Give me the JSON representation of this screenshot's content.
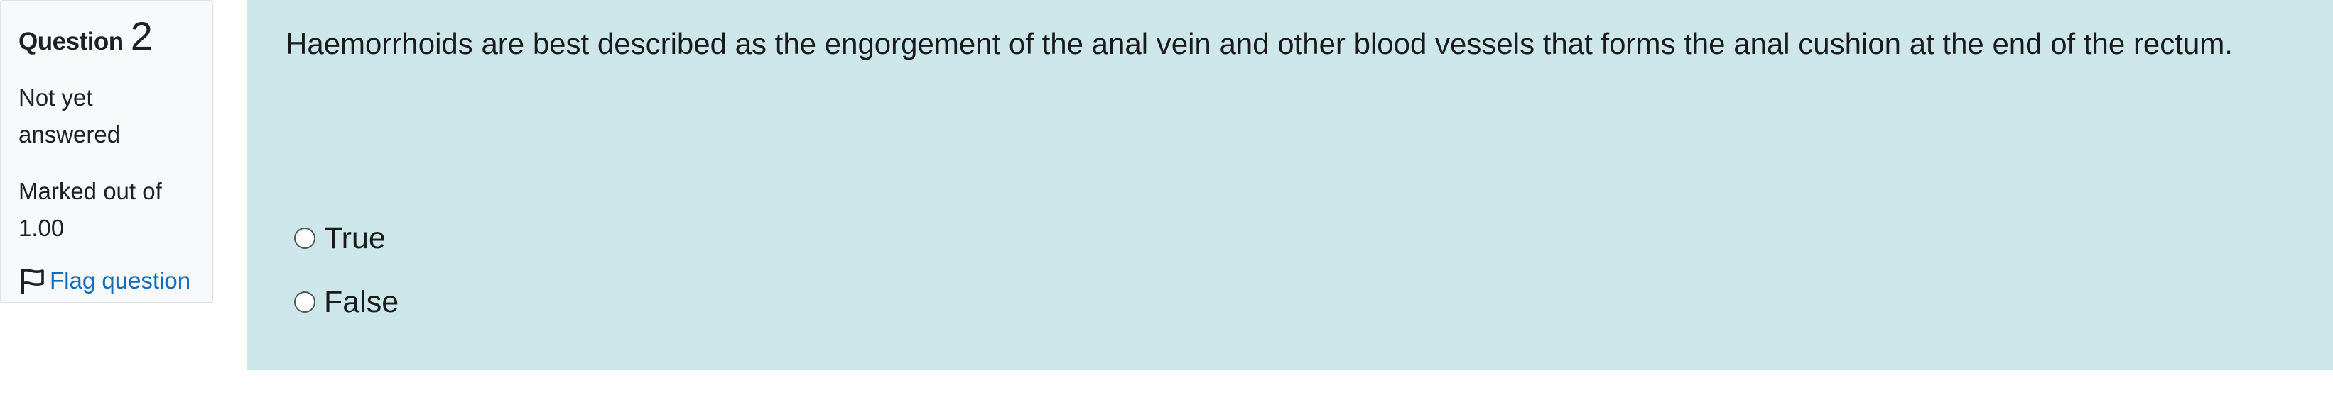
{
  "info": {
    "question_label": "Question",
    "question_number": "2",
    "state": "Not yet answered",
    "grade": "Marked out of 1.00",
    "flag_label": "Flag question",
    "flag_icon": "flag-icon"
  },
  "question": {
    "text": "Haemorrhoids are best described as the engorgement of the anal vein and other blood vessels that forms the anal cushion at the end of the rectum.",
    "options": [
      {
        "label": "True",
        "selected": false
      },
      {
        "label": "False",
        "selected": false
      }
    ]
  },
  "colors": {
    "content_background": "#cce6ea",
    "info_background": "#f8f9fa",
    "link": "#0f6cbf"
  }
}
